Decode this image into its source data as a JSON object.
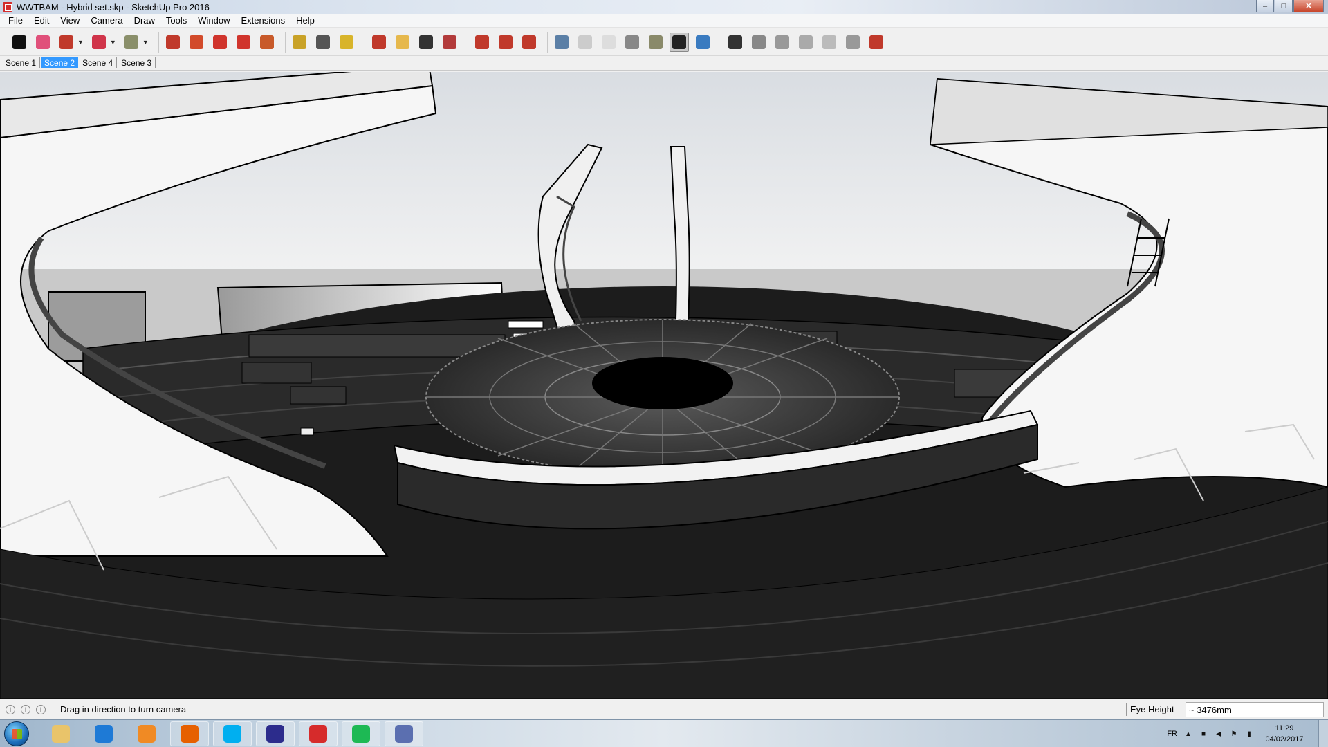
{
  "window": {
    "title": "WWTBAM - Hybrid set.skp - SketchUp Pro 2016",
    "minimize_glyph": "–",
    "maximize_glyph": "□",
    "close_glyph": "✕"
  },
  "menu": {
    "items": [
      "File",
      "Edit",
      "View",
      "Camera",
      "Draw",
      "Tools",
      "Window",
      "Extensions",
      "Help"
    ]
  },
  "toolbar": {
    "tools": [
      {
        "icon": "select-arrow-icon",
        "color": "#111111"
      },
      {
        "icon": "eraser-icon",
        "color": "#e0507a"
      },
      {
        "icon": "pencil-line-icon",
        "color": "#c0392b",
        "dropdown": true
      },
      {
        "icon": "arc-icon",
        "color": "#d0344a",
        "dropdown": true
      },
      {
        "icon": "circle-shape-icon",
        "color": "#8a8f6a",
        "dropdown": true
      },
      {
        "icon": "push-pull-icon",
        "color": "#c0392b"
      },
      {
        "icon": "follow-me-icon",
        "color": "#d24a2a"
      },
      {
        "icon": "move-icon",
        "color": "#d0342c"
      },
      {
        "icon": "rotate-icon",
        "color": "#d0342c"
      },
      {
        "icon": "scale-icon",
        "color": "#c85a2a"
      },
      {
        "icon": "tape-measure-icon",
        "color": "#c9a227"
      },
      {
        "icon": "text-label-icon",
        "color": "#555555"
      },
      {
        "icon": "paint-bucket-icon",
        "color": "#d8b42a"
      },
      {
        "icon": "orbit-icon",
        "color": "#c0392b"
      },
      {
        "icon": "pan-hand-icon",
        "color": "#e6b84c"
      },
      {
        "icon": "zoom-icon",
        "color": "#333333"
      },
      {
        "icon": "zoom-extents-icon",
        "color": "#b23a3a"
      },
      {
        "icon": "3d-warehouse-icon",
        "color": "#c0392b"
      },
      {
        "icon": "extension-warehouse-icon",
        "color": "#c0392b"
      },
      {
        "icon": "send-to-layout-icon",
        "color": "#c0392b"
      },
      {
        "icon": "xray-style-icon",
        "color": "#5b7fa6"
      },
      {
        "icon": "wireframe-style-icon",
        "color": "#cccccc"
      },
      {
        "icon": "hidden-line-style-icon",
        "color": "#dddddd"
      },
      {
        "icon": "shaded-style-icon",
        "color": "#888888"
      },
      {
        "icon": "shaded-with-textures-icon",
        "color": "#8a8a6a"
      },
      {
        "icon": "monochrome-style-icon",
        "color": "#222222",
        "active": true
      },
      {
        "icon": "blue-shaded-style-icon",
        "color": "#3a7bc0"
      },
      {
        "icon": "camera-position-icon",
        "color": "#333333"
      },
      {
        "icon": "look-around-icon",
        "color": "#888888"
      },
      {
        "icon": "walk-icon",
        "color": "#999999"
      },
      {
        "icon": "section-plane-icon",
        "color": "#aaaaaa"
      },
      {
        "icon": "display-section-planes-icon",
        "color": "#bbbbbb"
      },
      {
        "icon": "display-section-cuts-icon",
        "color": "#999999"
      },
      {
        "icon": "stop-record-icon",
        "color": "#c0392b"
      }
    ]
  },
  "scenes": {
    "tabs": [
      "Scene 1",
      "Scene 2",
      "Scene 4",
      "Scene 3"
    ],
    "active_index": 1
  },
  "status": {
    "message": "Drag in direction to turn camera",
    "vcb_label": "Eye Height",
    "vcb_value": "~ 3476mm"
  },
  "taskbar": {
    "apps": [
      {
        "icon": "file-explorer-icon",
        "color": "#e9c46a"
      },
      {
        "icon": "internet-explorer-icon",
        "color": "#1e7ad6"
      },
      {
        "icon": "media-player-icon",
        "color": "#f08a24"
      },
      {
        "icon": "firefox-icon",
        "color": "#e66000"
      },
      {
        "icon": "skype-icon",
        "color": "#00aff0"
      },
      {
        "icon": "audio-headphones-icon",
        "color": "#2c2c8c"
      },
      {
        "icon": "sketchup-icon",
        "color": "#d62b2b"
      },
      {
        "icon": "spotify-icon",
        "color": "#1db954"
      },
      {
        "icon": "discord-icon",
        "color": "#5b6fb0"
      }
    ],
    "tray": {
      "language": "FR",
      "time": "11:29",
      "date": "04/02/2017"
    }
  }
}
